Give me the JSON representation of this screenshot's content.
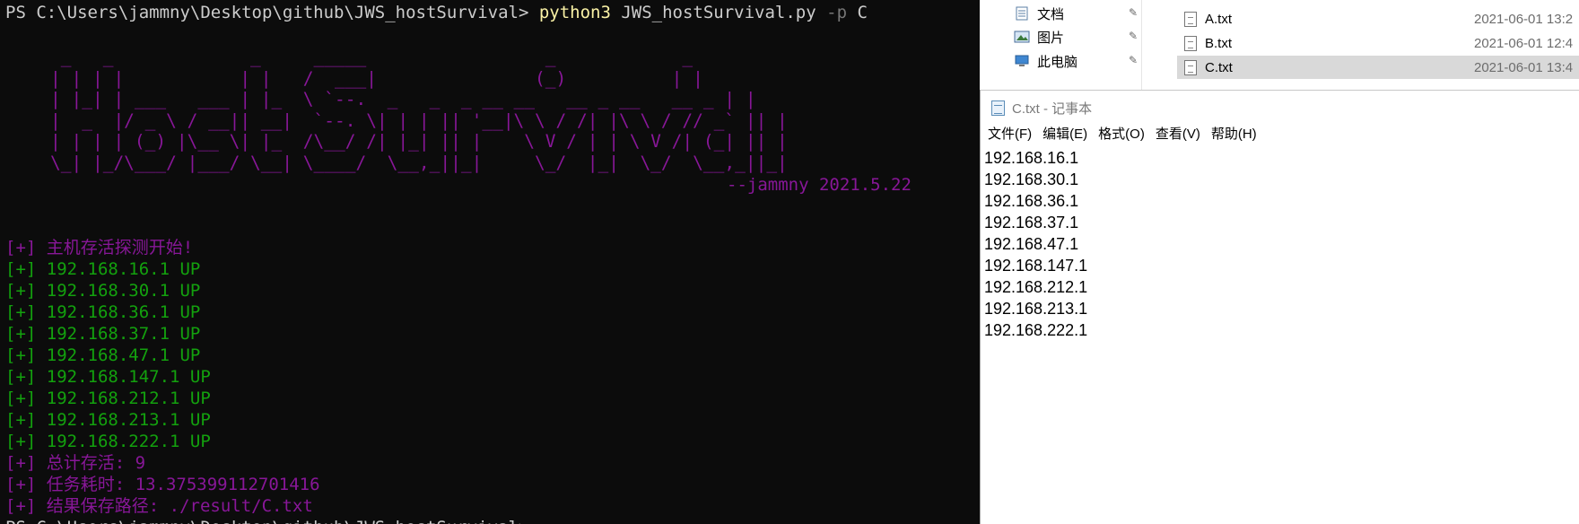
{
  "terminal": {
    "prompt": "PS C:\\Users\\jammny\\Desktop\\github\\JWS_hostSurvival> ",
    "command": "python3",
    "args": " JWS_hostSurvival.py ",
    "flag": "-p",
    "flag_value": " C",
    "banner": " _   _             _     _____                 _            _ \n| | | |           | |   /  ___|               (_)          | |\n| |_| | ___   ___ | |_  \\ `--.  _   _  _ __ __   __ _ __   __ _ | |\n|  _  |/ _ \\ / __|| __|  `--. \\| | | || '__|\\ \\ / /| |\\ \\ / // _` || |\n| | | | (_) |\\__ \\| |_  /\\__/ /| |_| || |    \\ V / | | \\ V /| (_| || |\n\\_| |_/\\___/ |___/ \\__| \\____/  \\__,_||_|     \\_/  |_|  \\_/  \\__,_||_|",
    "author": "--jammny 2021.5.22",
    "lines": [
      {
        "text": "[+] 主机存活探测开始!",
        "color": "magenta"
      },
      {
        "text": "[+] 192.168.16.1 UP",
        "color": "green"
      },
      {
        "text": "[+] 192.168.30.1 UP",
        "color": "green"
      },
      {
        "text": "[+] 192.168.36.1 UP",
        "color": "green"
      },
      {
        "text": "[+] 192.168.37.1 UP",
        "color": "green"
      },
      {
        "text": "[+] 192.168.47.1 UP",
        "color": "green"
      },
      {
        "text": "[+] 192.168.147.1 UP",
        "color": "green"
      },
      {
        "text": "[+] 192.168.212.1 UP",
        "color": "green"
      },
      {
        "text": "[+] 192.168.213.1 UP",
        "color": "green"
      },
      {
        "text": "[+] 192.168.222.1 UP",
        "color": "green"
      },
      {
        "text": "[+] 总计存活: 9",
        "color": "magenta"
      },
      {
        "text": "[+] 任务耗时: 13.375399112701416",
        "color": "magenta"
      },
      {
        "text": "[+] 结果保存路径: ./result/C.txt",
        "color": "magenta"
      }
    ],
    "next_prompt": "PS C:\\Users\\jammny\\Desktop\\github\\JWS_hostSurvival>"
  },
  "explorer": {
    "nav": [
      {
        "label": "文档",
        "icon": "documents-icon"
      },
      {
        "label": "图片",
        "icon": "pictures-icon"
      },
      {
        "label": "此电脑",
        "icon": "this-pc-icon"
      }
    ],
    "files": [
      {
        "name": "A.txt",
        "date": "2021-06-01 13:2"
      },
      {
        "name": "B.txt",
        "date": "2021-06-01 12:4"
      },
      {
        "name": "C.txt",
        "date": "2021-06-01 13:4",
        "selected": true
      }
    ]
  },
  "notepad": {
    "title": "C.txt - 记事本",
    "menu": [
      "文件(F)",
      "编辑(E)",
      "格式(O)",
      "查看(V)",
      "帮助(H)"
    ],
    "lines": [
      "192.168.16.1",
      "192.168.30.1",
      "192.168.36.1",
      "192.168.37.1",
      "192.168.47.1",
      "192.168.147.1",
      "192.168.212.1",
      "192.168.213.1",
      "192.168.222.1"
    ]
  }
}
